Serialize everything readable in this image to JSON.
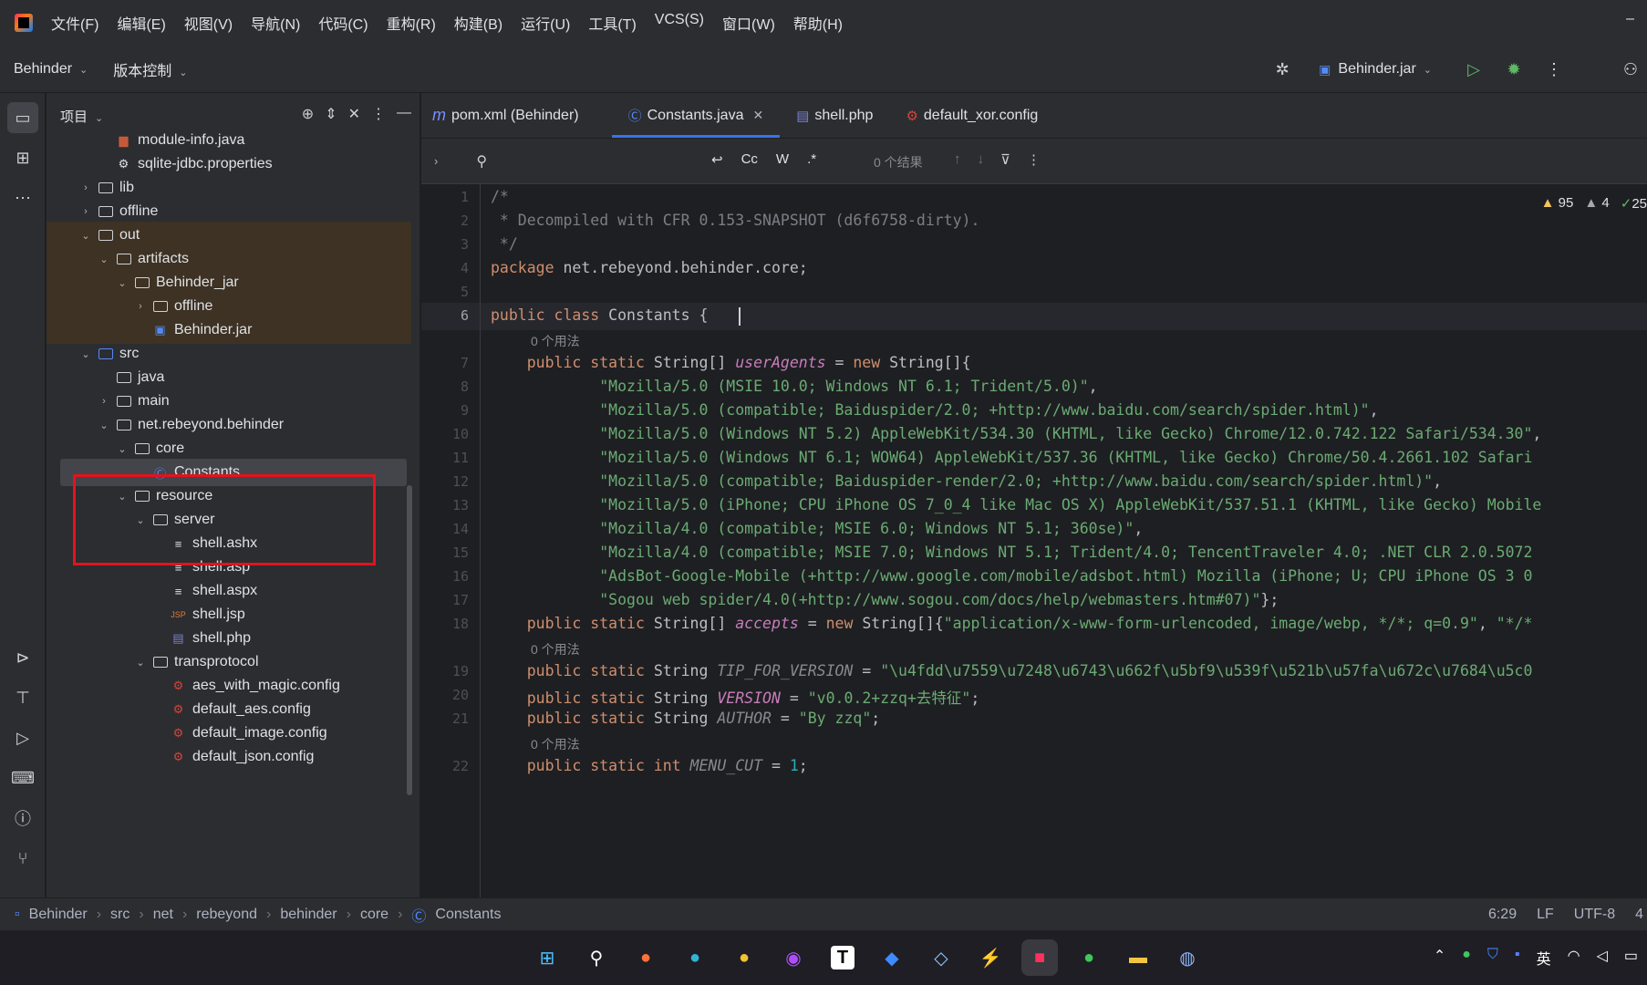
{
  "menubar": {
    "items": [
      "文件(F)",
      "编辑(E)",
      "视图(V)",
      "导航(N)",
      "代码(C)",
      "重构(R)",
      "构建(B)",
      "运行(U)",
      "工具(T)",
      "VCS(S)",
      "窗口(W)",
      "帮助(H)"
    ],
    "minimize": "–"
  },
  "toolbar": {
    "project": "Behinder",
    "vcs": "版本控制",
    "run_config": "Behinder.jar"
  },
  "project_panel": {
    "title": "项目",
    "tree": [
      {
        "label": "module-info.java",
        "icon": "java-file-icon",
        "depth": 3
      },
      {
        "label": "sqlite-jdbc.properties",
        "icon": "gear-icon",
        "depth": 3
      },
      {
        "label": "lib",
        "icon": "folder-icon",
        "depth": 2,
        "arrow": "›"
      },
      {
        "label": "offline",
        "icon": "folder-icon",
        "depth": 2,
        "arrow": "›"
      },
      {
        "label": "out",
        "icon": "folder-icon",
        "depth": 2,
        "arrow": "⌄"
      },
      {
        "label": "artifacts",
        "icon": "folder-icon",
        "depth": 3,
        "arrow": "⌄"
      },
      {
        "label": "Behinder_jar",
        "icon": "folder-icon",
        "depth": 4,
        "arrow": "⌄"
      },
      {
        "label": "offline",
        "icon": "folder-icon",
        "depth": 5,
        "arrow": "›"
      },
      {
        "label": "Behinder.jar",
        "icon": "jar-icon",
        "depth": 5
      },
      {
        "label": "src",
        "icon": "folder-icon",
        "depth": 2,
        "arrow": "⌄"
      },
      {
        "label": "java",
        "icon": "folder-icon",
        "depth": 3
      },
      {
        "label": "main",
        "icon": "package-icon",
        "depth": 3,
        "arrow": "›"
      },
      {
        "label": "net.rebeyond.behinder",
        "icon": "package-icon",
        "depth": 3,
        "arrow": "⌄"
      },
      {
        "label": "core",
        "icon": "package-icon",
        "depth": 4,
        "arrow": "⌄"
      },
      {
        "label": "Constants",
        "icon": "class-icon",
        "depth": 5
      },
      {
        "label": "resource",
        "icon": "package-icon",
        "depth": 4,
        "arrow": "⌄"
      },
      {
        "label": "server",
        "icon": "package-icon",
        "depth": 5,
        "arrow": "⌄"
      },
      {
        "label": "shell.ashx",
        "icon": "text-file-icon",
        "depth": 6
      },
      {
        "label": "shell.asp",
        "icon": "text-file-icon",
        "depth": 6
      },
      {
        "label": "shell.aspx",
        "icon": "text-file-icon",
        "depth": 6
      },
      {
        "label": "shell.jsp",
        "icon": "jsp-file-icon",
        "depth": 6
      },
      {
        "label": "shell.php",
        "icon": "php-file-icon",
        "depth": 6
      },
      {
        "label": "transprotocol",
        "icon": "package-icon",
        "depth": 5,
        "arrow": "⌄"
      },
      {
        "label": "aes_with_magic.config",
        "icon": "config-file-icon",
        "depth": 6
      },
      {
        "label": "default_aes.config",
        "icon": "config-file-icon",
        "depth": 6
      },
      {
        "label": "default_image.config",
        "icon": "config-file-icon",
        "depth": 6
      },
      {
        "label": "default_json.config",
        "icon": "config-file-icon",
        "depth": 6
      }
    ]
  },
  "tabs": [
    {
      "label": "pom.xml (Behinder)",
      "icon": "maven-icon",
      "glyph": "m"
    },
    {
      "label": "Constants.java",
      "icon": "class-icon",
      "glyph": "Ⓒ",
      "active": true
    },
    {
      "label": "shell.php",
      "icon": "php-file-icon",
      "glyph": "▤"
    },
    {
      "label": "default_xor.config",
      "icon": "config-file-icon",
      "glyph": "⚙"
    }
  ],
  "findbar": {
    "match_case": "Cc",
    "words": "W",
    "regex": ".*",
    "results": "0 个结果"
  },
  "inspections": {
    "warnings": "95",
    "weak_warnings": "4",
    "ok": "25"
  },
  "code": {
    "usage_hint": "0 个用法",
    "lines": [
      {
        "n": "1",
        "parts": [
          [
            "cm",
            "/*"
          ]
        ]
      },
      {
        "n": "2",
        "parts": [
          [
            "cm",
            " * Decompiled with CFR 0.153-SNAPSHOT (d6f6758-dirty)."
          ]
        ]
      },
      {
        "n": "3",
        "parts": [
          [
            "cm",
            " */"
          ]
        ]
      },
      {
        "n": "4",
        "parts": [
          [
            "kw",
            "package "
          ],
          [
            "",
            "net.rebeyond.behinder.core;"
          ]
        ]
      },
      {
        "n": "5",
        "parts": []
      },
      {
        "n": "6",
        "parts": [
          [
            "kw",
            "public class "
          ],
          [
            "",
            "Constants {"
          ]
        ],
        "current": true
      },
      {
        "n": "7",
        "parts": [
          [
            "kw",
            "    public static "
          ],
          [
            "",
            "String[] "
          ],
          [
            "fld",
            "userAgents"
          ],
          [
            "",
            " = "
          ],
          [
            "kw",
            "new "
          ],
          [
            "",
            "String[]{"
          ]
        ],
        "hint": true
      },
      {
        "n": "8",
        "parts": [
          [
            "str",
            "            \"Mozilla/5.0 (MSIE 10.0; Windows NT 6.1; Trident/5.0)\""
          ],
          [
            "",
            ","
          ]
        ]
      },
      {
        "n": "9",
        "parts": [
          [
            "str",
            "            \"Mozilla/5.0 (compatible; Baiduspider/2.0; +http://www.baidu.com/search/spider.html)\""
          ],
          [
            "",
            ","
          ]
        ]
      },
      {
        "n": "10",
        "parts": [
          [
            "str",
            "            \"Mozilla/5.0 (Windows NT 5.2) AppleWebKit/534.30 (KHTML, like Gecko) Chrome/12.0.742.122 Safari/534.30\""
          ],
          [
            "",
            ","
          ]
        ]
      },
      {
        "n": "11",
        "parts": [
          [
            "str",
            "            \"Mozilla/5.0 (Windows NT 6.1; WOW64) AppleWebKit/537.36 (KHTML, like Gecko) Chrome/50.4.2661.102 Safari"
          ]
        ]
      },
      {
        "n": "12",
        "parts": [
          [
            "str",
            "            \"Mozilla/5.0 (compatible; Baiduspider-render/2.0; +http://www.baidu.com/search/spider.html)\""
          ],
          [
            "",
            ","
          ]
        ]
      },
      {
        "n": "13",
        "parts": [
          [
            "str",
            "            \"Mozilla/5.0 (iPhone; CPU iPhone OS 7_0_4 like Mac OS X) AppleWebKit/537.51.1 (KHTML, like Gecko) Mobile"
          ]
        ]
      },
      {
        "n": "14",
        "parts": [
          [
            "str",
            "            \"Mozilla/4.0 (compatible; MSIE 6.0; Windows NT 5.1; 360se)\""
          ],
          [
            "",
            ","
          ]
        ]
      },
      {
        "n": "15",
        "parts": [
          [
            "str",
            "            \"Mozilla/4.0 (compatible; MSIE 7.0; Windows NT 5.1; Trident/4.0; TencentTraveler 4.0; .NET CLR 2.0.5072"
          ]
        ]
      },
      {
        "n": "16",
        "parts": [
          [
            "str",
            "            \"AdsBot-Google-Mobile (+http://www.google.com/mobile/adsbot.html) Mozilla (iPhone; U; CPU iPhone OS 3 0"
          ]
        ]
      },
      {
        "n": "17",
        "parts": [
          [
            "str",
            "            \"Sogou web spider/4.0(+http://www.sogou.com/docs/help/webmasters.htm#07)\""
          ],
          [
            "",
            "};"
          ]
        ]
      },
      {
        "n": "18",
        "parts": [
          [
            "kw",
            "    public static "
          ],
          [
            "",
            "String[] "
          ],
          [
            "fld",
            "accepts"
          ],
          [
            "",
            " = "
          ],
          [
            "kw",
            "new "
          ],
          [
            "",
            "String[]{"
          ],
          [
            "str",
            "\"application/x-www-form-urlencoded, image/webp, */*; q=0.9\""
          ],
          [
            "",
            ", "
          ],
          [
            "str",
            "\"*/*"
          ]
        ]
      },
      {
        "n": "19",
        "parts": [
          [
            "kw",
            "    public static "
          ],
          [
            "",
            "String "
          ],
          [
            "sf",
            "TIP_FOR_VERSION"
          ],
          [
            "",
            " = "
          ],
          [
            "str",
            "\"\\u4fdd\\u7559\\u7248\\u6743\\u662f\\u5bf9\\u539f\\u521b\\u57fa\\u672c\\u7684\\u5c0"
          ]
        ],
        "hint": true
      },
      {
        "n": "20",
        "parts": [
          [
            "kw",
            "    public static "
          ],
          [
            "",
            "String "
          ],
          [
            "fld",
            "VERSION"
          ],
          [
            "",
            " = "
          ],
          [
            "str",
            "\"v0.0.2+zzq+去特征\""
          ],
          [
            "",
            ";"
          ]
        ]
      },
      {
        "n": "21",
        "parts": [
          [
            "kw",
            "    public static "
          ],
          [
            "",
            "String "
          ],
          [
            "sf",
            "AUTHOR"
          ],
          [
            "",
            " = "
          ],
          [
            "str",
            "\"By zzq\""
          ],
          [
            "",
            ";"
          ]
        ]
      },
      {
        "n": "22",
        "parts": [
          [
            "kw",
            "    public static int "
          ],
          [
            "sf",
            "MENU_CUT"
          ],
          [
            "",
            " = "
          ],
          [
            "num",
            "1"
          ],
          [
            "",
            ";"
          ]
        ],
        "hint": true
      }
    ]
  },
  "statusbar": {
    "breadcrumbs": [
      "Behinder",
      "src",
      "net",
      "rebeyond",
      "behinder",
      "core",
      "Constants"
    ],
    "position": "6:29",
    "line_sep": "LF",
    "encoding": "UTF-8",
    "indent": "4"
  },
  "tray": {
    "lang": "英"
  }
}
